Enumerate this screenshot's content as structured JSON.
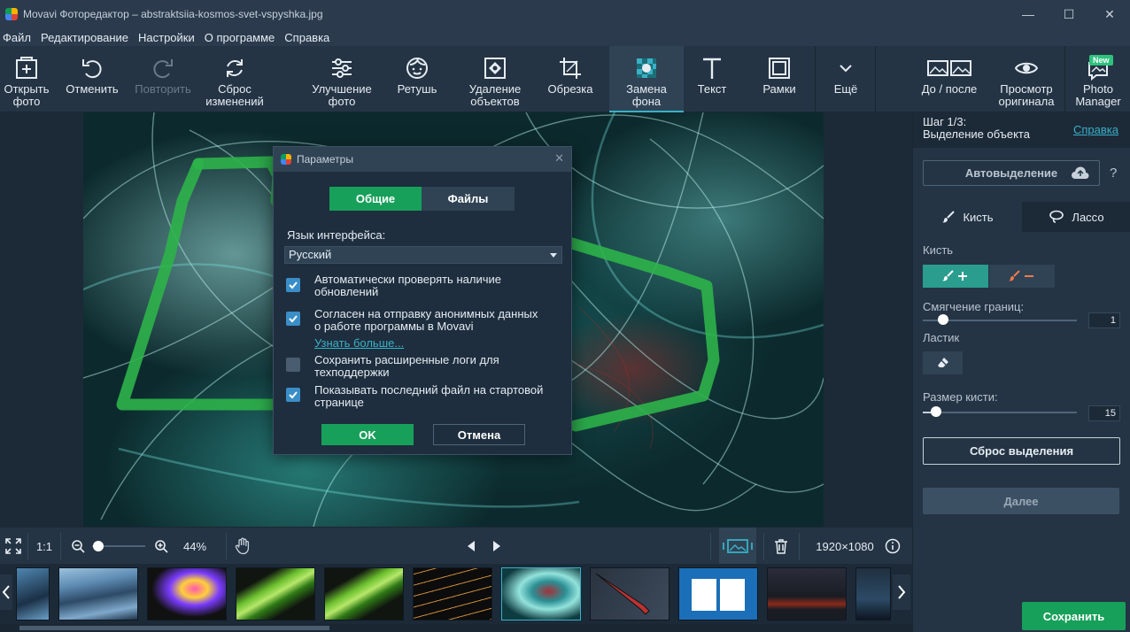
{
  "window": {
    "title": "Movavi Фоторедактор – abstraktsiia-kosmos-svet-vspyshka.jpg",
    "minimize": "—",
    "maximize": "☐",
    "close": "✕"
  },
  "menu": [
    "Файл",
    "Редактирование",
    "Настройки",
    "О программе",
    "Справка"
  ],
  "toolbar": {
    "open": "Открыть\nфото",
    "undo": "Отменить",
    "redo": "Повторить",
    "reset": "Сброс\nизменений",
    "enhance": "Улучшение\nфото",
    "retouch": "Ретушь",
    "remove": "Удаление\nобъектов",
    "crop": "Обрезка",
    "bg": "Замена\nфона",
    "text": "Текст",
    "frames": "Рамки",
    "more": "Ещё",
    "before_after": "До / после",
    "original": "Просмотр\nоригинала",
    "photo_manager": "Photo\nManager",
    "new_badge": "New"
  },
  "bottombar": {
    "ratio": "1:1",
    "zoom": "44%",
    "resolution": "1920×1080",
    "zoom_level": 0.12
  },
  "right_panel": {
    "step": "Шаг 1/3:\nВыделение объекта",
    "help_link": "Справка",
    "auto_select": "Автовыделение",
    "question": "?",
    "tab_brush": "Кисть",
    "tab_lasso": "Лассо",
    "brush_label": "Кисть",
    "feather_label": "Смягчение границ:",
    "feather_value": "1",
    "eraser_label": "Ластик",
    "brush_size_label": "Размер кисти:",
    "brush_size_value": "15",
    "reset_selection": "Сброс выделения",
    "next": "Далее",
    "save": "Сохранить"
  },
  "dialog": {
    "title": "Параметры",
    "tab_general": "Общие",
    "tab_files": "Файлы",
    "language_label": "Язык интерфейса:",
    "language_value": "Русский",
    "option1": "Автоматически проверять наличие\nобновлений",
    "option2": "Согласен на отправку анонимных данных\nо работе программы в Movavi",
    "learn_more": "Узнать больше...",
    "option3": "Сохранить расширенные логи для\nтехподдержки",
    "option4": "Показывать последний файл на стартовой\nстранице",
    "ok": "OK",
    "cancel": "Отмена"
  },
  "colors": {
    "accent_green": "#17a05a",
    "accent_teal": "#3ab0c6",
    "panel_bg": "#243444"
  }
}
